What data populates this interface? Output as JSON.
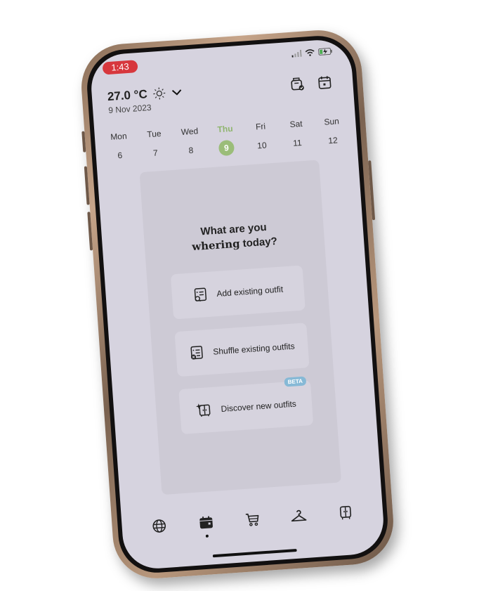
{
  "status_bar": {
    "time": "1:43"
  },
  "header": {
    "temperature": "27.0 °C",
    "weather_icon": "sun-icon",
    "date": "9 Nov 2023",
    "icons": [
      "laundry-basket-check-icon",
      "calendar-icon"
    ]
  },
  "week": [
    {
      "name": "Mon",
      "date": "6",
      "active": false
    },
    {
      "name": "Tue",
      "date": "7",
      "active": false
    },
    {
      "name": "Wed",
      "date": "8",
      "active": false
    },
    {
      "name": "Thu",
      "date": "9",
      "active": true
    },
    {
      "name": "Fri",
      "date": "10",
      "active": false
    },
    {
      "name": "Sat",
      "date": "11",
      "active": false
    },
    {
      "name": "Sun",
      "date": "12",
      "active": false
    }
  ],
  "main": {
    "question_line1": "What are you",
    "question_brand": "whering",
    "question_rest": " today?",
    "actions": [
      {
        "label": "Add existing outfit",
        "icon": "list-search-icon"
      },
      {
        "label": "Shuffle existing outfits",
        "icon": "list-shuffle-icon"
      },
      {
        "label": "Discover new outfits",
        "icon": "wardrobe-sparkle-icon",
        "badge": "BETA"
      }
    ]
  },
  "tabbar": {
    "items": [
      "globe-icon",
      "calendar-icon",
      "cart-icon",
      "hanger-icon",
      "wardrobe-icon"
    ],
    "active_index": 1
  },
  "colors": {
    "accent_green": "#9bbd79",
    "status_red": "#d7373d",
    "beta_blue": "#86b9d6",
    "screen_bg": "#d6d3df"
  }
}
